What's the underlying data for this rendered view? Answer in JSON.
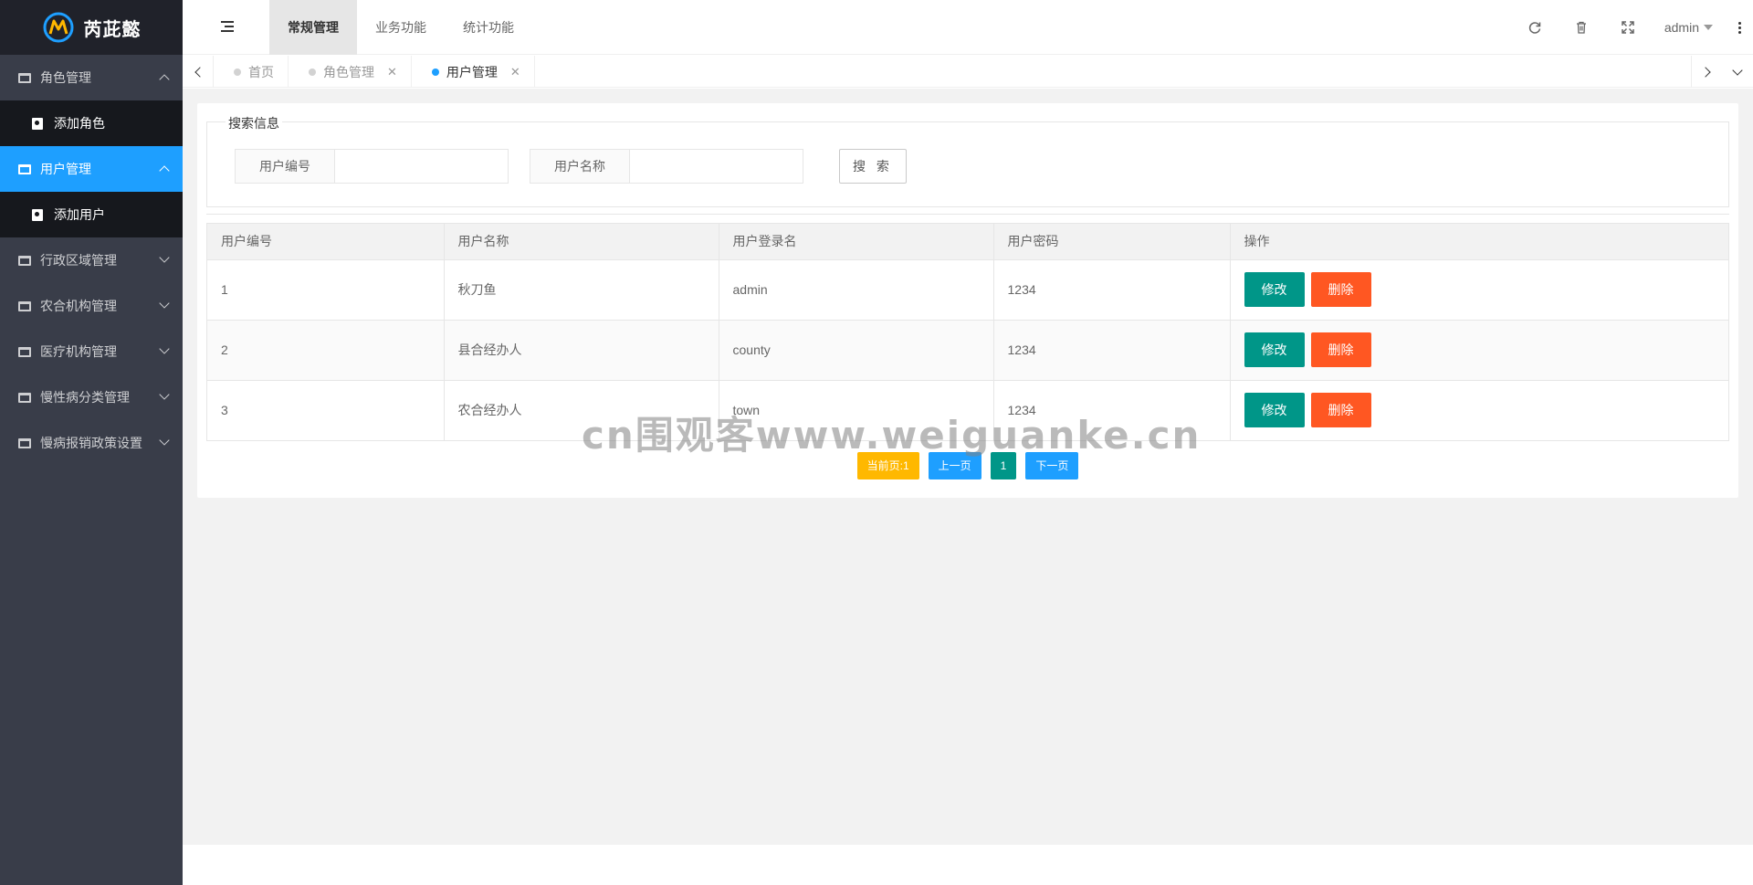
{
  "app": {
    "logo_text": "芮茈懿",
    "accent_color": "#1e9fff",
    "sidebar_bg": "#393d49"
  },
  "sidebar": {
    "items": [
      {
        "label": "角色管理",
        "icon": "window-icon",
        "expanded": true,
        "active": false
      },
      {
        "label": "添加角色",
        "icon": "contact-card-icon",
        "sub": true
      },
      {
        "label": "用户管理",
        "icon": "window-icon",
        "expanded": true,
        "active": true
      },
      {
        "label": "添加用户",
        "icon": "contact-card-icon",
        "sub": true
      },
      {
        "label": "行政区域管理",
        "icon": "window-icon",
        "expanded": false
      },
      {
        "label": "农合机构管理",
        "icon": "window-icon",
        "expanded": false
      },
      {
        "label": "医疗机构管理",
        "icon": "window-icon",
        "expanded": false
      },
      {
        "label": "慢性病分类管理",
        "icon": "window-icon",
        "expanded": false
      },
      {
        "label": "慢病报销政策设置",
        "icon": "window-icon",
        "expanded": false
      }
    ]
  },
  "header": {
    "tabs": [
      "常规管理",
      "业务功能",
      "统计功能"
    ],
    "active_tab": "常规管理",
    "user": "admin",
    "icons": [
      "refresh-icon",
      "trash-icon",
      "fullscreen-icon",
      "more-vertical-icon"
    ]
  },
  "page_tabs": [
    {
      "label": "首页",
      "closable": false,
      "active": false
    },
    {
      "label": "角色管理",
      "closable": true,
      "active": false
    },
    {
      "label": "用户管理",
      "closable": true,
      "active": true
    }
  ],
  "search": {
    "legend": "搜索信息",
    "user_id_label": "用户编号",
    "user_id_value": "",
    "user_name_label": "用户名称",
    "user_name_value": "",
    "button": "搜 索"
  },
  "table": {
    "columns": [
      "用户编号",
      "用户名称",
      "用户登录名",
      "用户密码",
      "操作"
    ],
    "rows": [
      {
        "id": "1",
        "name": "秋刀鱼",
        "login": "admin",
        "password": "1234"
      },
      {
        "id": "2",
        "name": "县合经办人",
        "login": "county",
        "password": "1234"
      },
      {
        "id": "3",
        "name": "农合经办人",
        "login": "town",
        "password": "1234"
      }
    ],
    "edit_label": "修改",
    "delete_label": "删除",
    "edit_color": "#009688",
    "delete_color": "#ff5722"
  },
  "pager": {
    "current": "当前页:1",
    "prev": "上一页",
    "page": "1",
    "next": "下一页"
  },
  "watermark": "cn围观客www.weiguanke.cn"
}
